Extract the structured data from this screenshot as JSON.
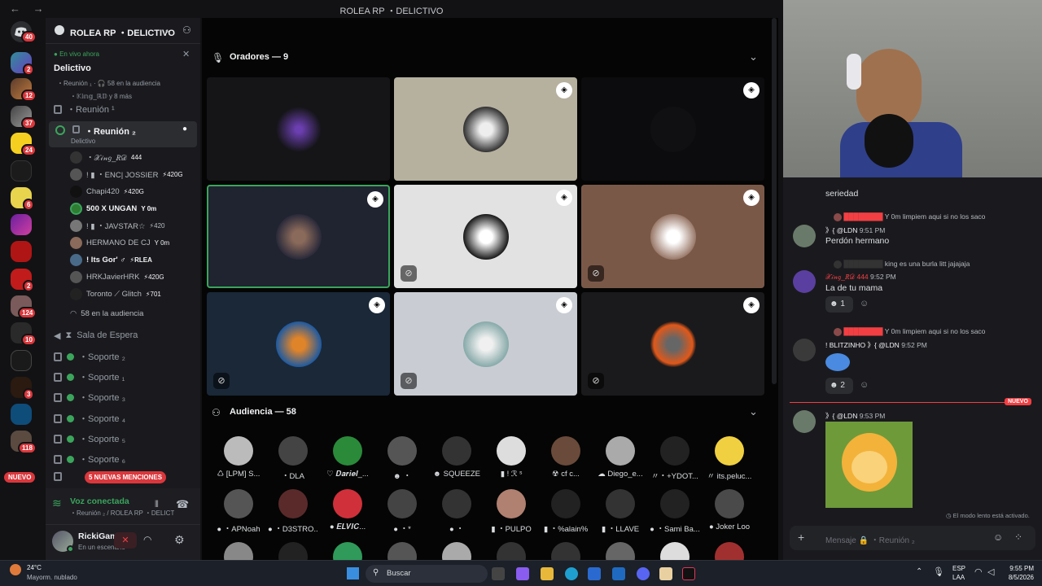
{
  "window": {
    "title": "ROLEA RP ・DELICTIVO",
    "nav": "← →"
  },
  "servers": {
    "dm_badge": "40",
    "badges": [
      "2",
      "12",
      "37",
      "24",
      "6",
      "2",
      "124",
      "10",
      "3",
      "118"
    ],
    "new_label": "NUEVO"
  },
  "server_header": {
    "name": "ROLEA RP ・DELICTIVO"
  },
  "live": {
    "label": "En vivo ahora",
    "title": "Delictivo",
    "sub": "・Reunión ₁ · 🎧 58 en la audiencia",
    "members": "・𝕂𝕚𝕟𝕘_ℝ𝔻 y 8 más"
  },
  "channels": {
    "reunion1": "・Reunión ¹",
    "reunion2": "・Reunión ₂",
    "reunion2_sub": "Delictivo",
    "members": [
      {
        "name": "・𝒳𝒾𝓃𝑔_𝑅𝒟",
        "tag": "444"
      },
      {
        "name": "! ▮ ・ENC| JOSSIER",
        "tag": "⚡420G"
      },
      {
        "name": "Chapi420",
        "tag": "⚡420G"
      },
      {
        "name": "500 X UNGAN",
        "tag": "Y 0m"
      },
      {
        "name": "! ▮ ・JAVSTAR☆",
        "tag": "⚡420"
      },
      {
        "name": "HERMANO DE CJ",
        "tag": "Y 0m"
      },
      {
        "name": "! Its Gor' ♂",
        "tag": "⚡RLEA"
      },
      {
        "name": "HRKJavierHRK",
        "tag": "⚡420G"
      },
      {
        "name": "Toronto ⟋ Glitch",
        "tag": "⚡701"
      }
    ],
    "audience": "58 en la audiencia",
    "wait": "Sala de Espera",
    "support": [
      "・Soporte ₂",
      "・Soporte ₁",
      "・Soporte ₃",
      "・Soporte ₄",
      "・Soporte ₅",
      "・Soporte ₆"
    ],
    "mentions": "5 NUEVAS MENCIONES",
    "new_pill": "NUEVO"
  },
  "voice": {
    "status": "Voz conectada",
    "channel": "・Reunión ₂ / ROLEA RP ・DELICT..."
  },
  "user": {
    "name": "RickiGamerR",
    "status": "En un escenario"
  },
  "stage": {
    "speakers_label": "Oradores — 9",
    "audience_label": "Audiencia — 58",
    "audience": [
      "♺ [LPM] S...",
      "・DLA",
      "♡ 𝑫𝒂𝒓𝒊𝒆𝒍_...",
      "☻ ・",
      "☻ SQUEEZE",
      "▮ ! ℛ ˢ",
      "☢ cf c...",
      "☁ Diego_e...",
      "〃・+YDOT...",
      "〃 its.peluc...",
      "● ・APNoah",
      "● ・D3STRO...",
      "● 𝑬𝑳𝑽𝑰𝑪...",
      "● ・*",
      "● ・",
      "▮ ・PULPO",
      "▮ ・%alain%",
      "▮ ・LLAVE",
      "● ・Sami Ba...",
      "● Joker Loo"
    ]
  },
  "chat": {
    "messages": [
      {
        "reply": "limpiem aqui si no los saco",
        "rtag": "Y 0m",
        "author": "》{ @LDN",
        "time": "9:51 PM",
        "text": "Perdón hermano"
      },
      {
        "reply": "king es una burla litt jajajaja",
        "rtag": "",
        "author": "𝒳𝒾𝓃𝑔_𝑅𝒟 444",
        "time": "9:52 PM",
        "text": "La de tu mama",
        "react": "1"
      },
      {
        "reply": "limpiem aqui si no los saco",
        "rtag": "Y 0m",
        "author": "! BLITZINHO 》{ @LDN",
        "time": "9:52 PM",
        "text": "",
        "react": "2"
      },
      {
        "reply": "",
        "rtag": "",
        "author": "》{ @LDN",
        "time": "9:53 PM",
        "text": ""
      }
    ],
    "top_text": "seriedad",
    "new_divider": "NUEVO",
    "slowmode": "El modo lento está activado.",
    "input_placeholder": "Mensaje 🔒 ・Reunión ₂"
  },
  "taskbar": {
    "temp": "24°C",
    "weather": "Mayorm. nublado",
    "search": "Buscar",
    "lang1": "ESP",
    "lang2": "LAA",
    "time": "9:55 PM",
    "date": "8/5/2026"
  }
}
